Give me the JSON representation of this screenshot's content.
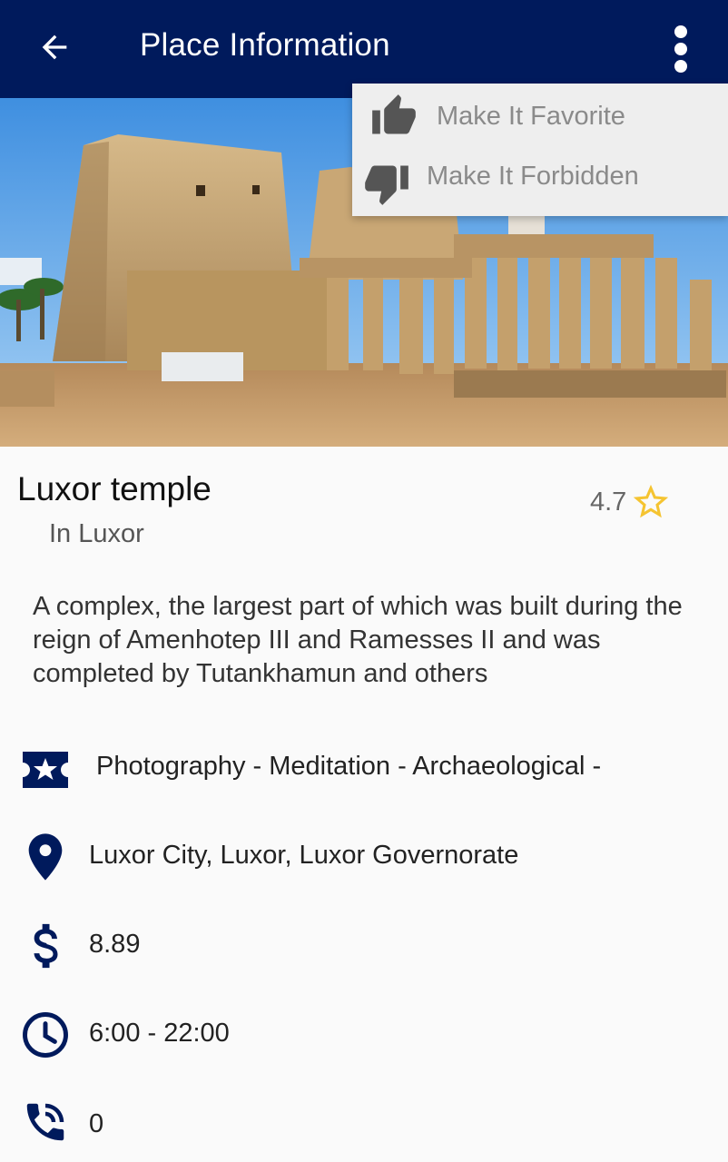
{
  "appbar": {
    "title": "Place Information",
    "background": "#001a5c"
  },
  "menu": {
    "favorite_label": "Make It Favorite",
    "forbidden_label": "Make It Forbidden"
  },
  "hero": {
    "alt": "Photo of Luxor temple"
  },
  "place": {
    "name": "Luxor temple",
    "city": "In Luxor",
    "rating": "4.7",
    "description": "A complex, the largest part of which was built during the reign of Amenhotep III and Ramesses II and was completed by Tutankhamun and others",
    "tags": "Photography - Meditation - Archaeological -",
    "location": "Luxor City, Luxor, Luxor Governorate",
    "price": "8.89",
    "hours": "6:00  -  22:00",
    "phone": "0"
  },
  "colors": {
    "primary": "#001a5c",
    "star": "#f5c431",
    "menu_text": "#8a8a8a"
  },
  "icons": {
    "back": "arrow-left-icon",
    "overflow": "more-vertical-icon",
    "favorite": "thumbs-up-icon",
    "forbidden": "thumbs-down-icon",
    "rating": "star-outline-icon",
    "tags": "ticket-star-icon",
    "location": "map-pin-icon",
    "price": "dollar-icon",
    "hours": "clock-icon",
    "phone": "phone-in-talk-icon"
  }
}
